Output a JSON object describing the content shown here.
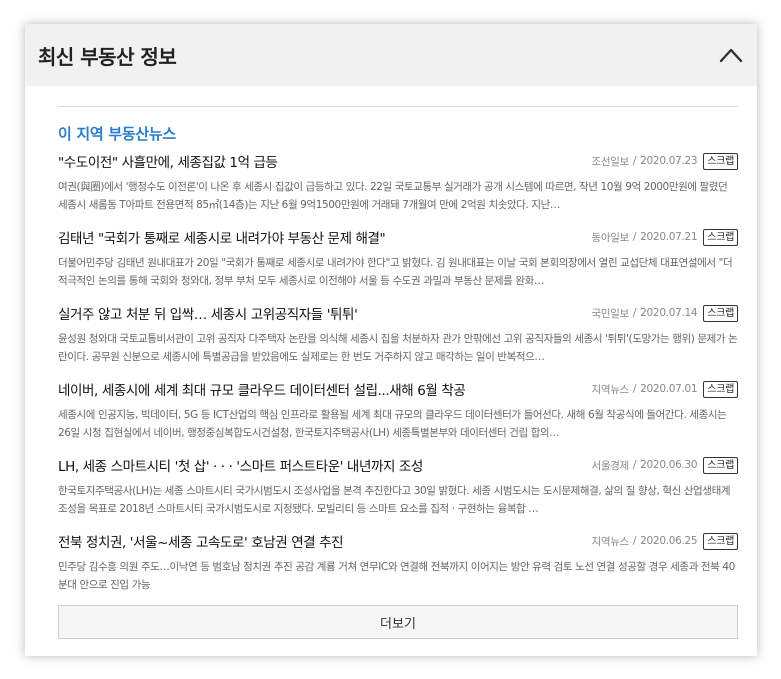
{
  "panel": {
    "title": "최신 부동산 정보"
  },
  "section": {
    "title": "이 지역 부동산뉴스"
  },
  "news": [
    {
      "title": "\"수도이전\" 사흘만에, 세종집값 1억 급등",
      "source": "조선일보",
      "date": "2020.07.23",
      "scrap_label": "스크랩",
      "summary": "여권(與圈)에서 '행정수도 이전론'이 나온 후 세종시 집값이 급등하고 있다. 22일 국토교통부 실거래가 공개 시스템에 따르면, 작년 10월 9억 2000만원에 팔렸던 세종시 새롬동 T아파트 전용면적 85㎡(14층)는 지난 6월 9억1500만원에 거래돼 7개월여 만에 2억원 치솟았다. 지난…"
    },
    {
      "title": "김태년 \"국회가 통째로 세종시로 내려가야 부동산 문제 해결\"",
      "source": "동아일보",
      "date": "2020.07.21",
      "scrap_label": "스크랩",
      "summary": "더불어민주당 김태년 원내대표가 20일 \"국회가 통째로 세종시로 내려가야 한다\"고 밝혔다. 김 원내대표는 이날 국회 본회의장에서 열린 교섭단체 대표연설에서 \"더 적극적인 논의를 통해 국회와 청와대, 정부 부처 모두 세종시로 이전해야 서울 등 수도권 과밀과 부동산 문제를 완화…"
    },
    {
      "title": "실거주 않고 처분 뒤 입싹… 세종시 고위공직자들 '튀튀'",
      "source": "국민일보",
      "date": "2020.07.14",
      "scrap_label": "스크랩",
      "summary": "윤성원 청와대 국토교통비서관이 고위 공직자 다주택자 논란을 의식해 세종시 집을 처분하자 관가 안팎에선 고위 공직자들의 세종시 '튀튀'(도망가는 행위) 문제가 논란이다. 공무원 신분으로 세종시에 특별공급을 받았음에도 실제로는 한 번도 거주하지 않고 매각하는 일이 반복적으…"
    },
    {
      "title": "네이버, 세종시에 세계 최대 규모 클라우드 데이터센터 설립...새해 6월 착공",
      "source": "지역뉴스",
      "date": "2020.07.01",
      "scrap_label": "스크랩",
      "summary": "세종시에 인공지능, 빅데이터, 5G 등 ICT산업의 핵심 인프라로 활용될 세계 최대 규모의 클라우드 데이터센터가 들어선다. 새해 6월 착공식에 들어간다. 세종시는 26일 시청 집현실에서 네이버, 행정중심복합도시건설청, 한국토지주택공사(LH) 세종특별본부와 데이터센터 건립 합의…"
    },
    {
      "title": "LH, 세종 스마트시티 '첫 삽' · · · '스마트 퍼스트타운' 내년까지 조성",
      "source": "서울경제",
      "date": "2020.06.30",
      "scrap_label": "스크랩",
      "summary": "한국토지주택공사(LH)는 세종 스마트시티 국가시범도시 조성사업을 본격 추진한다고 30일 밝혔다. 세종 시범도시는 도시문제해결, 삶의 질 향상, 혁신 산업생태계 조성을 목표로 2018년 스마트시티 국가시범도시로 지정됐다. 모빌리티 등 스마트 요소를 집적 · 구현하는 융복합 …"
    },
    {
      "title": "전북 정치권, '서울~세종 고속도로' 호남권 연결 추진",
      "source": "지역뉴스",
      "date": "2020.06.25",
      "scrap_label": "스크랩",
      "summary": "민주당 김수흥 의원 주도…이낙연 등 범호남 정치권 추진 공감 계룡 거쳐 연무IC와 연결해 전북까지 이어지는 방안 유력 검토 노선 연결 성공할 경우 세종과 전북 40분대 안으로 진입 가능"
    }
  ],
  "footer": {
    "more_label": "더보기"
  },
  "icons": {
    "collapse": "chevron-up-icon"
  },
  "colors": {
    "accent": "#2a7ec9",
    "header_bg": "#f1f1f1"
  }
}
